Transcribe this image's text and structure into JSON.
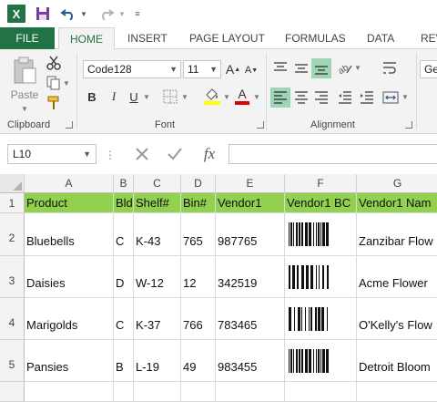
{
  "app": {
    "logo_letter": "X"
  },
  "tabs": [
    "FILE",
    "HOME",
    "INSERT",
    "PAGE LAYOUT",
    "FORMULAS",
    "DATA",
    "REV"
  ],
  "ribbon": {
    "paste_label": "Paste",
    "font_name": "Code128",
    "font_size": "11",
    "font_size_partial": "Ge",
    "groups": [
      "Clipboard",
      "Font",
      "Alignment"
    ],
    "bold": "B",
    "italic": "I",
    "underline": "U",
    "grow_font": "A",
    "shrink_font": "A"
  },
  "formula_bar": {
    "name_box": "L10",
    "fx": "fx",
    "value": ""
  },
  "columns": [
    "A",
    "B",
    "C",
    "D",
    "E",
    "F",
    "G"
  ],
  "rows": [
    "1",
    "2",
    "3",
    "4",
    "5"
  ],
  "header_row": [
    "Product",
    "Bld",
    "Shelf#",
    "Bin#",
    "Vendor1",
    "Vendor1 BC",
    "Vendor1 Nam"
  ],
  "data_rows": [
    [
      "Bluebells",
      "C",
      "K-43",
      "765",
      "987765",
      "",
      "Zanzibar Flow"
    ],
    [
      "Daisies",
      "D",
      "W-12",
      "12",
      "342519",
      "",
      "Acme Flower"
    ],
    [
      "Marigolds",
      "C",
      "K-37",
      "766",
      "783465",
      "",
      "O'Kelly's Flow"
    ],
    [
      "Pansies",
      "B",
      "L-19",
      "49",
      "983455",
      "",
      "Detroit Bloom"
    ]
  ],
  "colors": {
    "accent": "#217346",
    "header_fill": "#92d050",
    "selected": "#9fd5b7"
  }
}
